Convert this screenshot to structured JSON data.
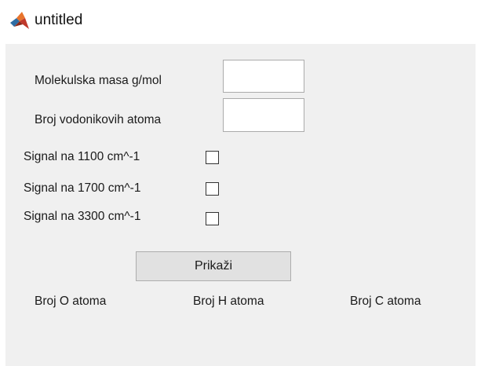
{
  "window": {
    "title": "untitled",
    "icon": "matlab-icon"
  },
  "form": {
    "molar_mass_label": "Molekulska masa g/mol",
    "molar_mass_value": "",
    "hydrogen_count_label": "Broj vodonikovih atoma",
    "hydrogen_count_value": "",
    "signal_1100_label": "Signal na 1100 cm^-1",
    "signal_1100_checked": false,
    "signal_1700_label": "Signal na 1700 cm^-1",
    "signal_1700_checked": false,
    "signal_3300_label": "Signal na 3300 cm^-1",
    "signal_3300_checked": false,
    "show_button_label": "Prikaži"
  },
  "results": {
    "oxygen_label": "Broj O atoma",
    "hydrogen_label": "Broj H atoma",
    "carbon_label": "Broj C atoma"
  }
}
